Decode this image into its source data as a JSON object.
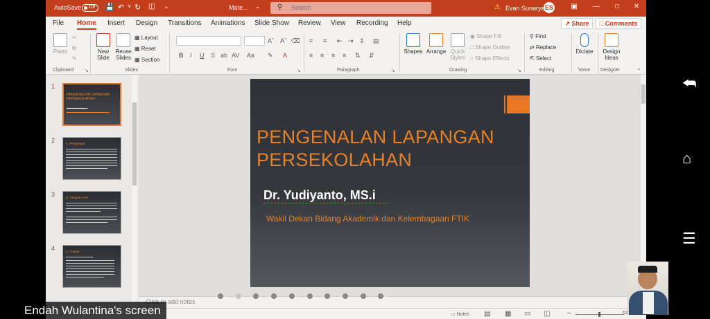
{
  "titlebar": {
    "autosave_label": "AutoSave",
    "autosave_state": "Off",
    "doc_title": "Mate...",
    "search_placeholder": "Search",
    "user_name": "Evan Sunarya",
    "user_initials": "ES"
  },
  "tabs": [
    "File",
    "Home",
    "Insert",
    "Design",
    "Transitions",
    "Animations",
    "Slide Show",
    "Review",
    "View",
    "Recording",
    "Help"
  ],
  "active_tab": "Home",
  "share_label": "Share",
  "comments_label": "Comments",
  "ribbon": {
    "clipboard": {
      "label": "Clipboard",
      "paste": "Paste"
    },
    "slides": {
      "label": "Slides",
      "new_slide": "New Slide",
      "reuse_slides": "Reuse Slides",
      "layout": "Layout",
      "reset": "Reset",
      "section": "Section"
    },
    "font": {
      "label": "Font",
      "bold": "B",
      "italic": "I",
      "underline": "U",
      "strike": "S",
      "shadow": "ab",
      "spacing": "AV",
      "case": "Aa"
    },
    "paragraph": {
      "label": "Paragraph"
    },
    "drawing": {
      "label": "Drawing",
      "shapes": "Shapes",
      "arrange": "Arrange",
      "quick_styles": "Quick Styles",
      "shape_fill": "Shape Fill",
      "shape_outline": "Shape Outline",
      "shape_effects": "Shape Effects"
    },
    "editing": {
      "label": "Editing",
      "find": "Find",
      "replace": "Replace",
      "select": "Select"
    },
    "voice": {
      "label": "Voice",
      "dictate": "Dictate"
    },
    "designer": {
      "label": "Designer",
      "design_ideas": "Design Ideas"
    }
  },
  "thumbnails": [
    {
      "num": "1",
      "title": "PENGENALAN LAPANGAN PERSEKOLAHAN"
    },
    {
      "num": "2",
      "title": "A. Pengertian"
    },
    {
      "num": "3",
      "title": "B. Tahapan PLP"
    },
    {
      "num": "4",
      "title": "C. Tujuan"
    }
  ],
  "slide": {
    "title_line1": "PENGENALAN LAPANGAN",
    "title_line2": "PERSEKOLAHAN",
    "author": "Dr. Yudiyanto, MS.i",
    "subtitle": "Wakil Dekan Bidang Akademik dan Kelembagaan FTIK"
  },
  "notes_placeholder": "Click to add notes",
  "status": {
    "notes": "Notes",
    "zoom": "62"
  },
  "screen_caption": "Endah Wulantina's screen",
  "colors": {
    "accent": "#c43e1c",
    "slide_orange": "#e8802a",
    "slide_bg": "#2f3237"
  }
}
